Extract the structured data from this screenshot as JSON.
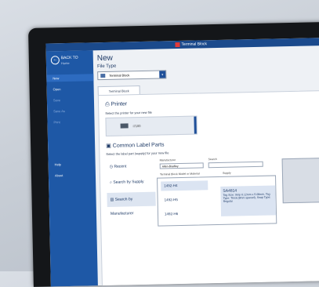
{
  "titlebar": {
    "title": "Terminal Block"
  },
  "sidebar": {
    "back_label": "BACK TO",
    "back_sub": "Home",
    "items": [
      {
        "label": "New",
        "active": true
      },
      {
        "label": "Open"
      },
      {
        "label": "Save"
      },
      {
        "label": "Save As"
      },
      {
        "label": "Print"
      },
      {
        "label": "Help"
      },
      {
        "label": "About"
      }
    ]
  },
  "main": {
    "heading": "New",
    "file_type_label": "File Type",
    "file_type_value": "Terminal Block",
    "tab_label": "Terminal Block",
    "printer_heading": "Printer",
    "printer_sub": "Select the printer for your new file",
    "printer_name": "i7100",
    "common_heading": "Common Label Parts",
    "common_sub": "Select the label part (supply) for your new file",
    "options": [
      "Recent",
      "Search by Supply",
      "Search by Manufacturer"
    ],
    "manufacturer_label": "Manufacturer",
    "manufacturer_value": "Allen-Bradley",
    "search_label": "Search",
    "model_label": "Terminal Block Model or Material",
    "supply_label": "Supply",
    "models": [
      "1492-H4",
      "1492-H5",
      "1492-H6"
    ],
    "supply_text": "SA4814",
    "supply_detail": "Tag Size: Strip 6.12mm x 5.08mm, Tag Type: Thick (8mm spaced), Snap Type: Regular"
  },
  "colors": {
    "accent": "#1e58a6",
    "title_bar": "#1b4a8c"
  }
}
